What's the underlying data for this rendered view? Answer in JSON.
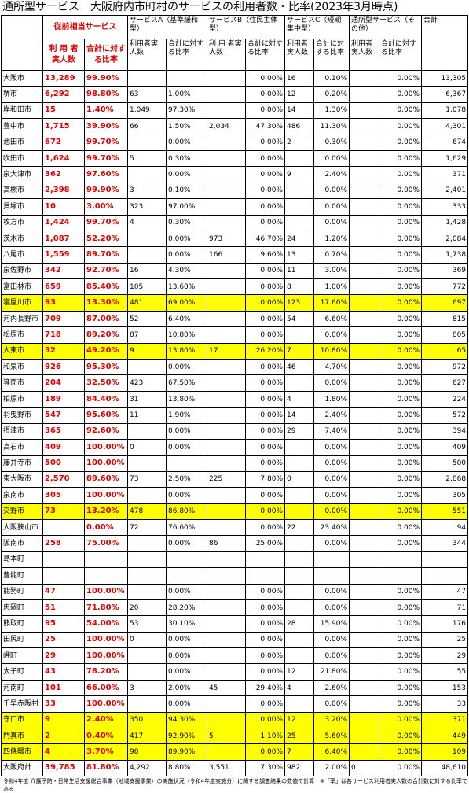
{
  "title": "通所型サービス　大阪府内市町村のサービスの利用者数・比率(2023年3月時点)",
  "headers": {
    "city": "",
    "legacy_group": "従前相当サービス",
    "legacy_users": "利 用 者 実人数",
    "legacy_ratio": "合計に対する比率",
    "serviceA": "サービスA（基準緩和型）",
    "serviceB": "サービスB（住民主体型）",
    "serviceC": "サービスC（短期集中型）",
    "other": "通所型サービス（その他）",
    "total": "合計",
    "users": "利用者実人数",
    "ratio": "合計に対する比率",
    "users_b": "利 用 者実人数",
    "users_c": "利用者実人数",
    "users_o": "利用者実人数"
  },
  "rows": [
    {
      "name": "大阪市",
      "l_users": "13,289",
      "l_ratio": "99.90%",
      "a_users": "",
      "a_ratio": "",
      "b_users": "",
      "b_ratio": "0.00%",
      "c_users": "16",
      "c_ratio": "0.10%",
      "o_users": "",
      "o_ratio": "0.00%",
      "total": "13,305",
      "hl": false
    },
    {
      "name": "堺市",
      "l_users": "6,292",
      "l_ratio": "98.80%",
      "a_users": "63",
      "a_ratio": "1.00%",
      "b_users": "",
      "b_ratio": "0.00%",
      "c_users": "12",
      "c_ratio": "0.20%",
      "o_users": "",
      "o_ratio": "0.00%",
      "total": "6,367",
      "hl": false
    },
    {
      "name": "岸和田市",
      "l_users": "15",
      "l_ratio": "1.40%",
      "a_users": "1,049",
      "a_ratio": "97.30%",
      "b_users": "",
      "b_ratio": "0.00%",
      "c_users": "14",
      "c_ratio": "1.30%",
      "o_users": "",
      "o_ratio": "0.00%",
      "total": "1,078",
      "hl": false
    },
    {
      "name": "豊中市",
      "l_users": "1,715",
      "l_ratio": "39.90%",
      "a_users": "66",
      "a_ratio": "1.50%",
      "b_users": "2,034",
      "b_ratio": "47.30%",
      "c_users": "486",
      "c_ratio": "11.30%",
      "o_users": "",
      "o_ratio": "0.00%",
      "total": "4,301",
      "hl": false
    },
    {
      "name": "池田市",
      "l_users": "672",
      "l_ratio": "99.70%",
      "a_users": "",
      "a_ratio": "0.00%",
      "b_users": "",
      "b_ratio": "0.00%",
      "c_users": "2",
      "c_ratio": "0.30%",
      "o_users": "",
      "o_ratio": "0.00%",
      "total": "674",
      "hl": false
    },
    {
      "name": "吹田市",
      "l_users": "1,624",
      "l_ratio": "99.70%",
      "a_users": "5",
      "a_ratio": "0.30%",
      "b_users": "",
      "b_ratio": "0.00%",
      "c_users": "",
      "c_ratio": "0.00%",
      "o_users": "",
      "o_ratio": "0.00%",
      "total": "1,629",
      "hl": false
    },
    {
      "name": "泉大津市",
      "l_users": "362",
      "l_ratio": "97.60%",
      "a_users": "",
      "a_ratio": "0.00%",
      "b_users": "",
      "b_ratio": "0.00%",
      "c_users": "9",
      "c_ratio": "2.40%",
      "o_users": "",
      "o_ratio": "0.00%",
      "total": "371",
      "hl": false
    },
    {
      "name": "高槻市",
      "l_users": "2,398",
      "l_ratio": "99.90%",
      "a_users": "3",
      "a_ratio": "0.10%",
      "b_users": "",
      "b_ratio": "0.00%",
      "c_users": "",
      "c_ratio": "0.00%",
      "o_users": "",
      "o_ratio": "0.00%",
      "total": "2,401",
      "hl": false
    },
    {
      "name": "貝塚市",
      "l_users": "10",
      "l_ratio": "3.00%",
      "a_users": "323",
      "a_ratio": "97.00%",
      "b_users": "",
      "b_ratio": "0.00%",
      "c_users": "",
      "c_ratio": "0.00%",
      "o_users": "",
      "o_ratio": "0.00%",
      "total": "333",
      "hl": false
    },
    {
      "name": "枚方市",
      "l_users": "1,424",
      "l_ratio": "99.70%",
      "a_users": "4",
      "a_ratio": "0.30%",
      "b_users": "",
      "b_ratio": "0.00%",
      "c_users": "",
      "c_ratio": "0.00%",
      "o_users": "",
      "o_ratio": "0.00%",
      "total": "1,428",
      "hl": false
    },
    {
      "name": "茨木市",
      "l_users": "1,087",
      "l_ratio": "52.20%",
      "a_users": "",
      "a_ratio": "0.00%",
      "b_users": "973",
      "b_ratio": "46.70%",
      "c_users": "24",
      "c_ratio": "1.20%",
      "o_users": "",
      "o_ratio": "0.00%",
      "total": "2,084",
      "hl": false
    },
    {
      "name": "八尾市",
      "l_users": "1,559",
      "l_ratio": "89.70%",
      "a_users": "",
      "a_ratio": "0.00%",
      "b_users": "166",
      "b_ratio": "9.60%",
      "c_users": "13",
      "c_ratio": "0.70%",
      "o_users": "",
      "o_ratio": "0.00%",
      "total": "1,738",
      "hl": false
    },
    {
      "name": "泉佐野市",
      "l_users": "342",
      "l_ratio": "92.70%",
      "a_users": "16",
      "a_ratio": "4.30%",
      "b_users": "",
      "b_ratio": "0.00%",
      "c_users": "11",
      "c_ratio": "3.00%",
      "o_users": "",
      "o_ratio": "0.00%",
      "total": "369",
      "hl": false
    },
    {
      "name": "富田林市",
      "l_users": "659",
      "l_ratio": "85.40%",
      "a_users": "105",
      "a_ratio": "13.60%",
      "b_users": "",
      "b_ratio": "0.00%",
      "c_users": "8",
      "c_ratio": "1.00%",
      "o_users": "",
      "o_ratio": "0.00%",
      "total": "772",
      "hl": false
    },
    {
      "name": "寝屋川市",
      "l_users": "93",
      "l_ratio": "13.30%",
      "a_users": "481",
      "a_ratio": "69.00%",
      "b_users": "",
      "b_ratio": "0.00%",
      "c_users": "123",
      "c_ratio": "17.60%",
      "o_users": "",
      "o_ratio": "0.00%",
      "total": "697",
      "hl": true
    },
    {
      "name": "河内長野市",
      "l_users": "709",
      "l_ratio": "87.00%",
      "a_users": "52",
      "a_ratio": "6.40%",
      "b_users": "",
      "b_ratio": "0.00%",
      "c_users": "54",
      "c_ratio": "6.60%",
      "o_users": "",
      "o_ratio": "0.00%",
      "total": "815",
      "hl": false
    },
    {
      "name": "松原市",
      "l_users": "718",
      "l_ratio": "89.20%",
      "a_users": "87",
      "a_ratio": "10.80%",
      "b_users": "",
      "b_ratio": "0.00%",
      "c_users": "",
      "c_ratio": "0.00%",
      "o_users": "",
      "o_ratio": "0.00%",
      "total": "805",
      "hl": false
    },
    {
      "name": "大東市",
      "l_users": "32",
      "l_ratio": "49.20%",
      "a_users": "9",
      "a_ratio": "13.80%",
      "b_users": "17",
      "b_ratio": "26.20%",
      "c_users": "7",
      "c_ratio": "10.80%",
      "o_users": "",
      "o_ratio": "0.00%",
      "total": "65",
      "hl": true
    },
    {
      "name": "和泉市",
      "l_users": "926",
      "l_ratio": "95.30%",
      "a_users": "",
      "a_ratio": "0.00%",
      "b_users": "",
      "b_ratio": "0.00%",
      "c_users": "46",
      "c_ratio": "4.70%",
      "o_users": "",
      "o_ratio": "0.00%",
      "total": "972",
      "hl": false
    },
    {
      "name": "箕面市",
      "l_users": "204",
      "l_ratio": "32.50%",
      "a_users": "423",
      "a_ratio": "67.50%",
      "b_users": "",
      "b_ratio": "0.00%",
      "c_users": "",
      "c_ratio": "0.00%",
      "o_users": "",
      "o_ratio": "0.00%",
      "total": "627",
      "hl": false
    },
    {
      "name": "柏原市",
      "l_users": "189",
      "l_ratio": "84.40%",
      "a_users": "31",
      "a_ratio": "13.80%",
      "b_users": "",
      "b_ratio": "0.00%",
      "c_users": "4",
      "c_ratio": "1.80%",
      "o_users": "",
      "o_ratio": "0.00%",
      "total": "224",
      "hl": false
    },
    {
      "name": "羽曳野市",
      "l_users": "547",
      "l_ratio": "95.60%",
      "a_users": "11",
      "a_ratio": "1.90%",
      "b_users": "",
      "b_ratio": "0.00%",
      "c_users": "14",
      "c_ratio": "2.40%",
      "o_users": "",
      "o_ratio": "0.00%",
      "total": "572",
      "hl": false
    },
    {
      "name": "摂津市",
      "l_users": "365",
      "l_ratio": "92.60%",
      "a_users": "",
      "a_ratio": "0.00%",
      "b_users": "",
      "b_ratio": "0.00%",
      "c_users": "29",
      "c_ratio": "7.40%",
      "o_users": "",
      "o_ratio": "0.00%",
      "total": "394",
      "hl": false
    },
    {
      "name": "高石市",
      "l_users": "409",
      "l_ratio": "100.00%",
      "a_users": "0",
      "a_ratio": "0.00%",
      "b_users": "",
      "b_ratio": "0.00%",
      "c_users": "",
      "c_ratio": "0.00%",
      "o_users": "",
      "o_ratio": "0.00%",
      "total": "409",
      "hl": false
    },
    {
      "name": "藤井寺市",
      "l_users": "500",
      "l_ratio": "100.00%",
      "a_users": "",
      "a_ratio": "",
      "b_users": "",
      "b_ratio": "0.00%",
      "c_users": "",
      "c_ratio": "0.00%",
      "o_users": "",
      "o_ratio": "0.00%",
      "total": "500",
      "hl": false
    },
    {
      "name": "東大阪市",
      "l_users": "2,570",
      "l_ratio": "89.60%",
      "a_users": "73",
      "a_ratio": "2.50%",
      "b_users": "225",
      "b_ratio": "7.80%",
      "c_users": "0",
      "c_ratio": "0.00%",
      "o_users": "",
      "o_ratio": "0.00%",
      "total": "2,868",
      "hl": false
    },
    {
      "name": "泉南市",
      "l_users": "305",
      "l_ratio": "100.00%",
      "a_users": "",
      "a_ratio": "0.00%",
      "b_users": "",
      "b_ratio": "0.00%",
      "c_users": "",
      "c_ratio": "0.00%",
      "o_users": "",
      "o_ratio": "0.00%",
      "total": "305",
      "hl": false
    },
    {
      "name": "交野市",
      "l_users": "73",
      "l_ratio": "13.20%",
      "a_users": "478",
      "a_ratio": "86.80%",
      "b_users": "",
      "b_ratio": "0.00%",
      "c_users": "",
      "c_ratio": "0.00%",
      "o_users": "",
      "o_ratio": "0.00%",
      "total": "551",
      "hl": true
    },
    {
      "name": "大阪狭山市",
      "l_users": "",
      "l_ratio": "0.00%",
      "a_users": "72",
      "a_ratio": "76.60%",
      "b_users": "",
      "b_ratio": "0.00%",
      "c_users": "22",
      "c_ratio": "23.40%",
      "o_users": "",
      "o_ratio": "0.00%",
      "total": "94",
      "hl": false
    },
    {
      "name": "阪南市",
      "l_users": "258",
      "l_ratio": "75.00%",
      "a_users": "",
      "a_ratio": "0.00%",
      "b_users": "86",
      "b_ratio": "25.00%",
      "c_users": "",
      "c_ratio": "0.00%",
      "o_users": "",
      "o_ratio": "0.00%",
      "total": "344",
      "hl": false
    },
    {
      "name": "島本町",
      "l_users": "",
      "l_ratio": "",
      "a_users": "",
      "a_ratio": "",
      "b_users": "",
      "b_ratio": "",
      "c_users": "",
      "c_ratio": "",
      "o_users": "",
      "o_ratio": "",
      "total": "",
      "hl": false
    },
    {
      "name": "豊能町",
      "l_users": "",
      "l_ratio": "",
      "a_users": "",
      "a_ratio": "",
      "b_users": "",
      "b_ratio": "",
      "c_users": "",
      "c_ratio": "",
      "o_users": "",
      "o_ratio": "",
      "total": "",
      "hl": false
    },
    {
      "name": "能勢町",
      "l_users": "47",
      "l_ratio": "100.00%",
      "a_users": "",
      "a_ratio": "0.00%",
      "b_users": "",
      "b_ratio": "0.00%",
      "c_users": "",
      "c_ratio": "0.00%",
      "o_users": "",
      "o_ratio": "0.00%",
      "total": "47",
      "hl": false
    },
    {
      "name": "忠岡町",
      "l_users": "51",
      "l_ratio": "71.80%",
      "a_users": "20",
      "a_ratio": "28.20%",
      "b_users": "",
      "b_ratio": "0.00%",
      "c_users": "",
      "c_ratio": "0.00%",
      "o_users": "",
      "o_ratio": "0.00%",
      "total": "71",
      "hl": false
    },
    {
      "name": "熊取町",
      "l_users": "95",
      "l_ratio": "54.00%",
      "a_users": "53",
      "a_ratio": "30.10%",
      "b_users": "",
      "b_ratio": "0.00%",
      "c_users": "28",
      "c_ratio": "15.90%",
      "o_users": "",
      "o_ratio": "0.00%",
      "total": "176",
      "hl": false
    },
    {
      "name": "田尻町",
      "l_users": "25",
      "l_ratio": "100.00%",
      "a_users": "0",
      "a_ratio": "0.00%",
      "b_users": "",
      "b_ratio": "0.00%",
      "c_users": "",
      "c_ratio": "0.00%",
      "o_users": "",
      "o_ratio": "0.00%",
      "total": "25",
      "hl": false
    },
    {
      "name": "岬町",
      "l_users": "29",
      "l_ratio": "100.00%",
      "a_users": "",
      "a_ratio": "0.00%",
      "b_users": "",
      "b_ratio": "0.00%",
      "c_users": "",
      "c_ratio": "0.00%",
      "o_users": "",
      "o_ratio": "0.00%",
      "total": "29",
      "hl": false
    },
    {
      "name": "太子町",
      "l_users": "43",
      "l_ratio": "78.20%",
      "a_users": "",
      "a_ratio": "0.00%",
      "b_users": "",
      "b_ratio": "0.00%",
      "c_users": "12",
      "c_ratio": "21.80%",
      "o_users": "",
      "o_ratio": "0.00%",
      "total": "55",
      "hl": false
    },
    {
      "name": "河南町",
      "l_users": "101",
      "l_ratio": "66.00%",
      "a_users": "3",
      "a_ratio": "2.00%",
      "b_users": "45",
      "b_ratio": "29.40%",
      "c_users": "4",
      "c_ratio": "2.60%",
      "o_users": "",
      "o_ratio": "0.00%",
      "total": "153",
      "hl": false
    },
    {
      "name": "千早赤阪村",
      "l_users": "33",
      "l_ratio": "100.00%",
      "a_users": "",
      "a_ratio": "0.00%",
      "b_users": "",
      "b_ratio": "0.00%",
      "c_users": "",
      "c_ratio": "0.00%",
      "o_users": "",
      "o_ratio": "0.00%",
      "total": "33",
      "hl": false
    },
    {
      "name": "守口市",
      "l_users": "9",
      "l_ratio": "2.40%",
      "a_users": "350",
      "a_ratio": "94.30%",
      "b_users": "",
      "b_ratio": "0.00%",
      "c_users": "12",
      "c_ratio": "3.20%",
      "o_users": "",
      "o_ratio": "0.00%",
      "total": "371",
      "hl": true
    },
    {
      "name": "門真市",
      "l_users": "2",
      "l_ratio": "0.40%",
      "a_users": "417",
      "a_ratio": "92.90%",
      "b_users": "5",
      "b_ratio": "1.10%",
      "c_users": "25",
      "c_ratio": "5.60%",
      "o_users": "",
      "o_ratio": "0.00%",
      "total": "449",
      "hl": true
    },
    {
      "name": "四條畷市",
      "l_users": "4",
      "l_ratio": "3.70%",
      "a_users": "98",
      "a_ratio": "89.90%",
      "b_users": "",
      "b_ratio": "0.00%",
      "c_users": "7",
      "c_ratio": "6.40%",
      "o_users": "",
      "o_ratio": "0.00%",
      "total": "109",
      "hl": true
    },
    {
      "name": "大阪府計",
      "l_users": "39,785",
      "l_ratio": "81.80%",
      "a_users": "4,292",
      "a_ratio": "8.80%",
      "b_users": "3,551",
      "b_ratio": "7.30%",
      "c_users": "982",
      "c_ratio": "2.00%",
      "o_users": "0",
      "o_ratio": "0.00%",
      "total": "48,610",
      "hl": false
    }
  ],
  "footnote": "令和4年度 介護予防・日常生活支援総合事業（地域支援事業）の実施状況（令和4年度実施分）に関する調査結果の数値で計算　※「率」は各サービス利用者実人数の合計数に対する比率である"
}
